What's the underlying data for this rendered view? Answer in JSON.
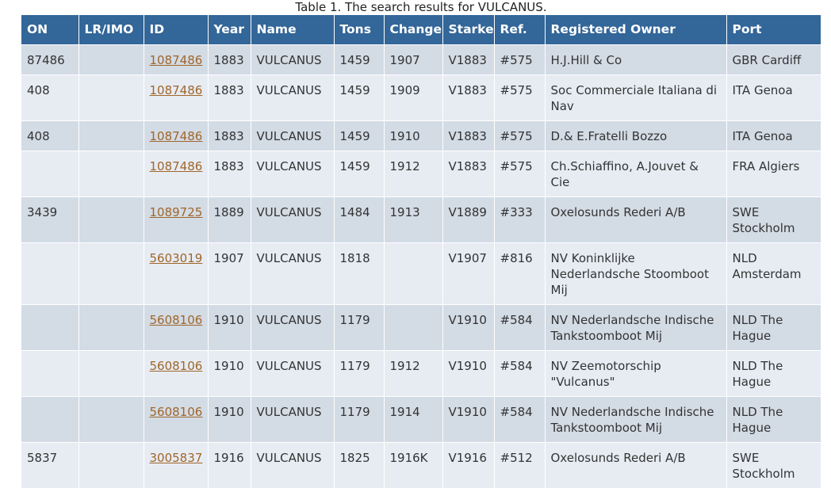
{
  "caption": "Table 1. The search results for VULCANUS.",
  "headers": [
    "ON",
    "LR/IMO",
    "ID",
    "Year",
    "Name",
    "Tons",
    "Change",
    "Starke",
    "Ref.",
    "Registered Owner",
    "Port"
  ],
  "rows": [
    {
      "on": "87486",
      "lrimo": "",
      "id": "1087486",
      "year": "1883",
      "name": "VULCANUS",
      "tons": "1459",
      "change": "1907",
      "starke": "V1883",
      "ref": "#575",
      "owner": "H.J.Hill & Co",
      "port": "GBR Cardiff"
    },
    {
      "on": "408",
      "lrimo": "",
      "id": "1087486",
      "year": "1883",
      "name": "VULCANUS",
      "tons": "1459",
      "change": "1909",
      "starke": "V1883",
      "ref": "#575",
      "owner": "Soc Commerciale Italiana di Nav",
      "port": "ITA Genoa"
    },
    {
      "on": "408",
      "lrimo": "",
      "id": "1087486",
      "year": "1883",
      "name": "VULCANUS",
      "tons": "1459",
      "change": "1910",
      "starke": "V1883",
      "ref": "#575",
      "owner": "D.& E.Fratelli Bozzo",
      "port": "ITA Genoa"
    },
    {
      "on": "",
      "lrimo": "",
      "id": "1087486",
      "year": "1883",
      "name": "VULCANUS",
      "tons": "1459",
      "change": "1912",
      "starke": "V1883",
      "ref": "#575",
      "owner": "Ch.Schiaffino, A.Jouvet & Cie",
      "port": "FRA Algiers"
    },
    {
      "on": "3439",
      "lrimo": "",
      "id": "1089725",
      "year": "1889",
      "name": "VULCANUS",
      "tons": "1484",
      "change": "1913",
      "starke": "V1889",
      "ref": "#333",
      "owner": "Oxelosunds Rederi A/B",
      "port": "SWE Stockholm"
    },
    {
      "on": "",
      "lrimo": "",
      "id": "5603019",
      "year": "1907",
      "name": "VULCANUS",
      "tons": "1818",
      "change": "",
      "starke": "V1907",
      "ref": "#816",
      "owner": "NV Koninklijke Nederlandsche Stoomboot Mij",
      "port": "NLD Amsterdam"
    },
    {
      "on": "",
      "lrimo": "",
      "id": "5608106",
      "year": "1910",
      "name": "VULCANUS",
      "tons": "1179",
      "change": "",
      "starke": "V1910",
      "ref": "#584",
      "owner": "NV Nederlandsche Indische Tankstoomboot Mij",
      "port": "NLD The Hague"
    },
    {
      "on": "",
      "lrimo": "",
      "id": "5608106",
      "year": "1910",
      "name": "VULCANUS",
      "tons": "1179",
      "change": "1912",
      "starke": "V1910",
      "ref": "#584",
      "owner": "NV Zeemotorschip \"Vulcanus\"",
      "port": "NLD The Hague"
    },
    {
      "on": "",
      "lrimo": "",
      "id": "5608106",
      "year": "1910",
      "name": "VULCANUS",
      "tons": "1179",
      "change": "1914",
      "starke": "V1910",
      "ref": "#584",
      "owner": "NV Nederlandsche Indische Tankstoomboot Mij",
      "port": "NLD The Hague"
    },
    {
      "on": "5837",
      "lrimo": "",
      "id": "3005837",
      "year": "1916",
      "name": "VULCANUS",
      "tons": "1825",
      "change": "1916K",
      "starke": "V1916",
      "ref": "#512",
      "owner": "Oxelosunds Rederi A/B",
      "port": "SWE Stockholm"
    }
  ]
}
